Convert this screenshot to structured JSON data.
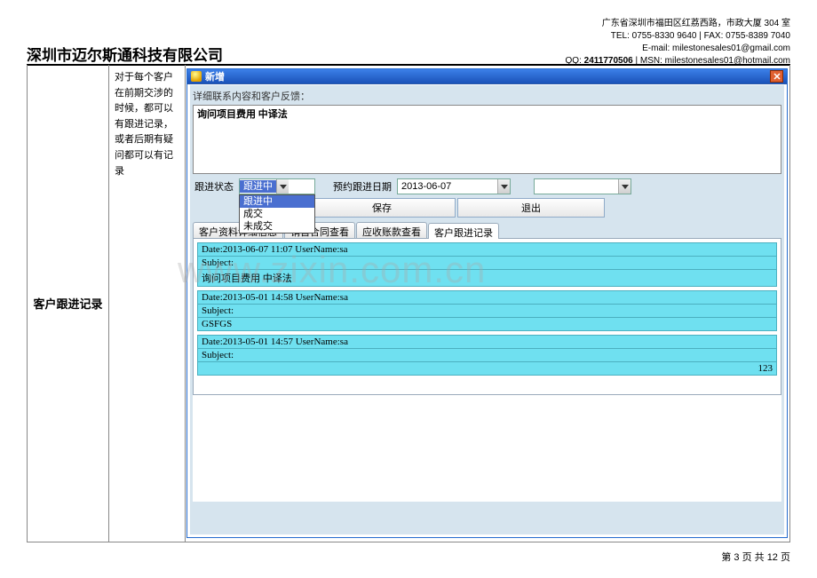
{
  "header": {
    "address": "广东省深圳市福田区红荔西路，市政大厦 304 室",
    "tel_label": "TEL:",
    "tel": "0755-8330 9640",
    "fax_label": "FAX:",
    "fax": "0755-8389 7040",
    "email_label": "E-mail:",
    "email": "milestonesales01@gmail.com",
    "qq_label": "QQ:",
    "qq": "2411770506",
    "msn_label": "MSN:",
    "msn": "milestonesales01@hotmail.com",
    "sep": " | "
  },
  "company": "深圳市迈尔斯通科技有限公司",
  "left": {
    "title": "客户跟进记录",
    "desc": "对于每个客户在前期交涉的时候，都可以有跟进记录，或者后期有疑问都可以有记录"
  },
  "window": {
    "title": "新增",
    "detail_label": "详细联系内容和客户反馈：",
    "detail_text": "询问项目费用    中译法",
    "status_label": "跟进状态",
    "status_selected": "跟进中",
    "status_options": [
      "跟进中",
      "成交",
      "未成交"
    ],
    "date_label": "预约跟进日期",
    "date_value": "2013-06-07",
    "extra_value": "",
    "save_btn": "保存",
    "exit_btn": "退出"
  },
  "tabs": [
    "客户资料详细信息",
    "销售合同查看",
    "应收账款查看",
    "客户跟进记录"
  ],
  "records": [
    {
      "date": "Date:2013-06-07 11:07    UserName:sa",
      "subject": "Subject:",
      "body": "询问项目费用    中译法"
    },
    {
      "date": "Date:2013-05-01 14:58    UserName:sa",
      "subject": "Subject:",
      "body": "GSFGS"
    },
    {
      "date": "Date:2013-05-01 14:57    UserName:sa",
      "subject": "Subject:",
      "body_right": "123"
    }
  ],
  "pagination": {
    "prefix": "第 ",
    "cur": "3",
    "mid": " 页 共 ",
    "total": "12",
    "suffix": " 页"
  },
  "watermark": "www.zixin.com.cn"
}
